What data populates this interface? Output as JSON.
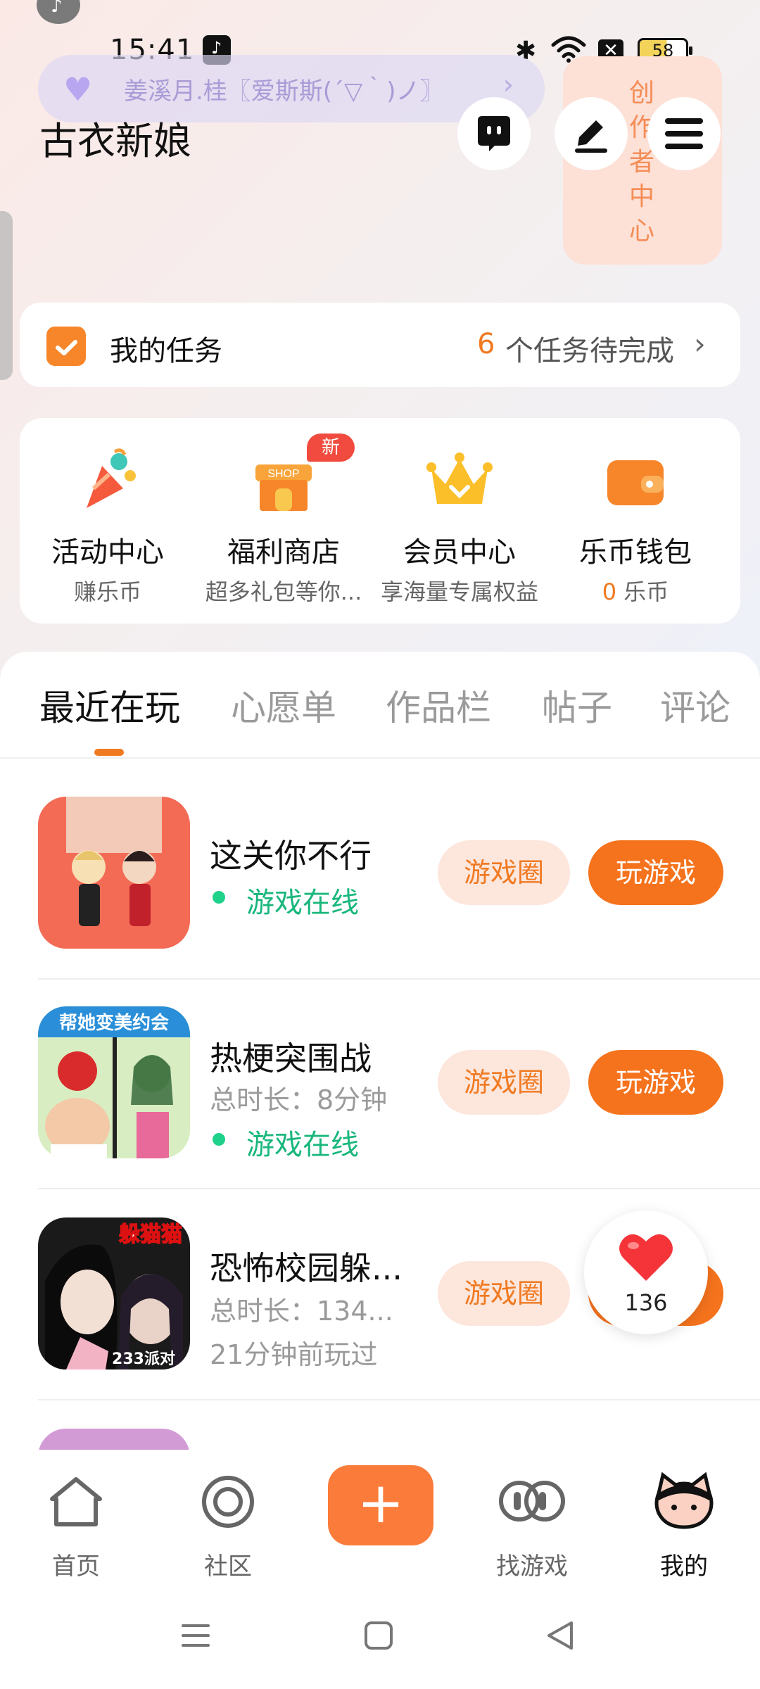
{
  "status_bar": {
    "time": "15:41",
    "battery": "58"
  },
  "header": {
    "signature": "姜溪月.桂〖爱斯斯(´▽｀)ノ〗",
    "nickname": "古衣新娘",
    "creator_center": "创作者中心"
  },
  "tasks": {
    "label": "我的任务",
    "count": "6",
    "suffix": "个任务待完成"
  },
  "quick_grid": [
    {
      "title": "活动中心",
      "sub": "赚乐币"
    },
    {
      "title": "福利商店",
      "sub": "超多礼包等你...",
      "badge": "新"
    },
    {
      "title": "会员中心",
      "sub": "享海量专属权益"
    },
    {
      "title": "乐币钱包",
      "sub_num": "0",
      "sub": "乐币"
    }
  ],
  "tabs": [
    "最近在玩",
    "心愿单",
    "作品栏",
    "帖子",
    "评论"
  ],
  "games": [
    {
      "name": "这关你不行",
      "online": "游戏在线",
      "circle_btn": "游戏圈",
      "play_btn": "玩游戏"
    },
    {
      "name": "热梗突围战",
      "meta": "总时长：8分钟",
      "online": "游戏在线",
      "circle_btn": "游戏圈",
      "play_btn": "玩游戏"
    },
    {
      "name": "恐怖校园躲...",
      "meta": "总时长：134...",
      "meta2": "21分钟前玩过",
      "circle_btn": "游戏圈",
      "thumb_text": "躲猫猫"
    }
  ],
  "thumb_labels": {
    "g2": "帮她变美约会",
    "g3_corner": "233派对"
  },
  "like": {
    "count": "136"
  },
  "bottom_nav": [
    {
      "label": "首页"
    },
    {
      "label": "社区"
    },
    {
      "label": "找游戏"
    },
    {
      "label": "我的"
    }
  ],
  "colors": {
    "accent": "#f5731d",
    "online": "#19b77c",
    "badge": "#f04b3e"
  }
}
